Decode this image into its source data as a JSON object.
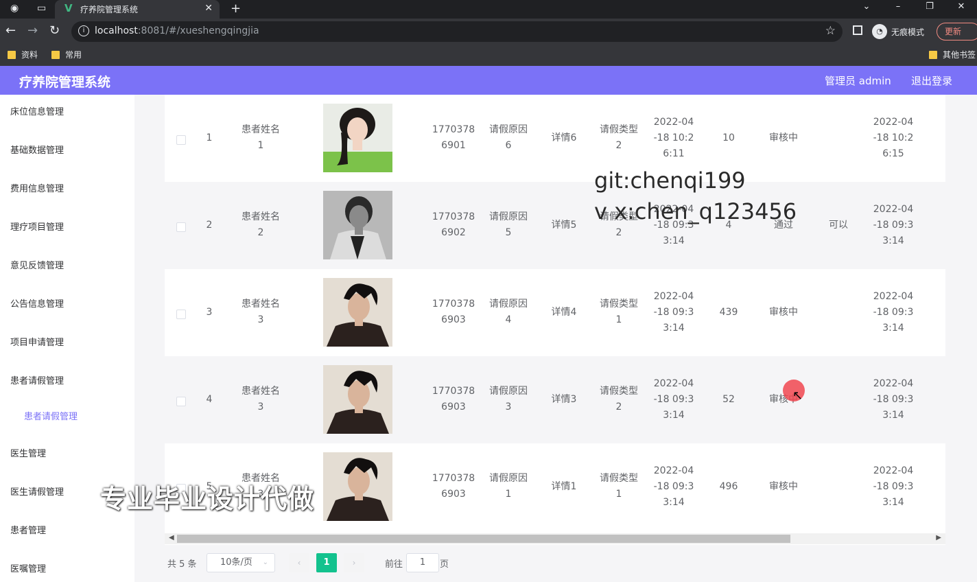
{
  "browser": {
    "tab_title": "疗养院管理系统",
    "url_host": "localhost",
    "url_rest": ":8081/#/xueshengqingjia",
    "incognito_label": "无痕模式",
    "update_label": "更新",
    "bookmarks": [
      "资料",
      "常用"
    ],
    "other_bookmarks": "其他书签"
  },
  "header": {
    "title": "疗养院管理系统",
    "admin": "管理员 admin",
    "logout": "退出登录"
  },
  "sidebar": {
    "items": [
      "床位信息管理",
      "基础数据管理",
      "费用信息管理",
      "理疗项目管理",
      "意见反馈管理",
      "公告信息管理",
      "项目申请管理",
      "患者请假管理",
      "患者请假管理",
      "医生管理",
      "医生请假管理",
      "患者管理",
      "医嘱管理"
    ]
  },
  "table": {
    "rows": [
      {
        "idx": "1",
        "name": [
          "患者姓名",
          "1"
        ],
        "phone": [
          "1770378",
          "6901"
        ],
        "reason": [
          "请假原因",
          "6"
        ],
        "detail": "详情6",
        "type": [
          "请假类型",
          "2"
        ],
        "date1": [
          "2022-04",
          "-18 10:2",
          "6:11"
        ],
        "days": "10",
        "status": "审核中",
        "reply": "",
        "date2": [
          "2022-04",
          "-18 10:2",
          "6:15"
        ]
      },
      {
        "idx": "2",
        "name": [
          "患者姓名",
          "2"
        ],
        "phone": [
          "1770378",
          "6902"
        ],
        "reason": [
          "请假原因",
          "5"
        ],
        "detail": "详情5",
        "type": [
          "请假类型",
          "2"
        ],
        "date1": [
          "2022-04",
          "-18 09:3",
          "3:14"
        ],
        "days": "4",
        "status": "通过",
        "reply": "可以",
        "date2": [
          "2022-04",
          "-18 09:3",
          "3:14"
        ]
      },
      {
        "idx": "3",
        "name": [
          "患者姓名",
          "3"
        ],
        "phone": [
          "1770378",
          "6903"
        ],
        "reason": [
          "请假原因",
          "4"
        ],
        "detail": "详情4",
        "type": [
          "请假类型",
          "1"
        ],
        "date1": [
          "2022-04",
          "-18 09:3",
          "3:14"
        ],
        "days": "439",
        "status": "审核中",
        "reply": "",
        "date2": [
          "2022-04",
          "-18 09:3",
          "3:14"
        ]
      },
      {
        "idx": "4",
        "name": [
          "患者姓名",
          "3"
        ],
        "phone": [
          "1770378",
          "6903"
        ],
        "reason": [
          "请假原因",
          "3"
        ],
        "detail": "详情3",
        "type": [
          "请假类型",
          "2"
        ],
        "date1": [
          "2022-04",
          "-18 09:3",
          "3:14"
        ],
        "days": "52",
        "status": "审核中",
        "reply": "",
        "date2": [
          "2022-04",
          "-18 09:3",
          "3:14"
        ]
      },
      {
        "idx": "5",
        "name": [
          "患者姓名",
          "3"
        ],
        "phone": [
          "1770378",
          "6903"
        ],
        "reason": [
          "请假原因",
          "1"
        ],
        "detail": "详情1",
        "type": [
          "请假类型",
          "1"
        ],
        "date1": [
          "2022-04",
          "-18 09:3",
          "3:14"
        ],
        "days": "496",
        "status": "审核中",
        "reply": "",
        "date2": [
          "2022-04",
          "-18 09:3",
          "3:14"
        ]
      }
    ]
  },
  "pager": {
    "total": "共 5 条",
    "page_size": "10条/页",
    "current": "1",
    "goto_label": "前往",
    "goto_value": "1",
    "goto_suffix": "页"
  },
  "overlay": {
    "watermark_git": "git:chenqi199",
    "watermark_vx": "v x:chen_q123456",
    "banner": "专业毕业设计代做"
  }
}
